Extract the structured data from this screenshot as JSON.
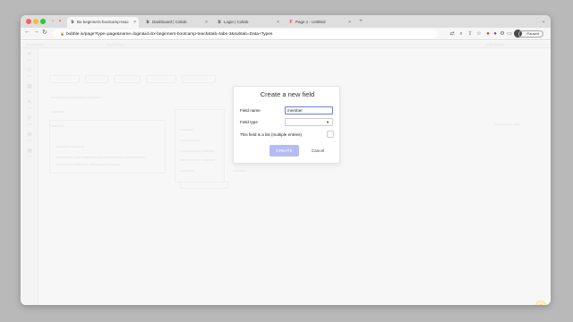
{
  "browser": {
    "tabs": [
      {
        "label": "Bx-beginners-bootcamp-teac",
        "active": true,
        "favicon": "bubble-logo"
      },
      {
        "label": "Dashboard | Collab",
        "active": false,
        "favicon": "bubble-logo"
      },
      {
        "label": "Login | Collab",
        "active": false,
        "favicon": "bubble-logo"
      },
      {
        "label": "Page 1 - Untitled",
        "active": false,
        "favicon": "figma-logo"
      }
    ],
    "url": "bubble.io/page?type=page&name=login&id=bx-beginners-bootcamp-teach&tab=tabs-3&subtab=Data+Types",
    "profile_status": "Paused",
    "colors": {
      "close": "#ff5f57",
      "minimize": "#febc2e",
      "maximize": "#28c840"
    }
  },
  "modal": {
    "title": "Create a new field",
    "field_name_label": "Field name",
    "field_name_value": "member",
    "field_type_label": "Field type",
    "field_type_value": "",
    "list_label": "This field is a list (multiple entries)",
    "create_label": "CREATE",
    "cancel_label": "Cancel",
    "accent": "#6a7ee0"
  }
}
